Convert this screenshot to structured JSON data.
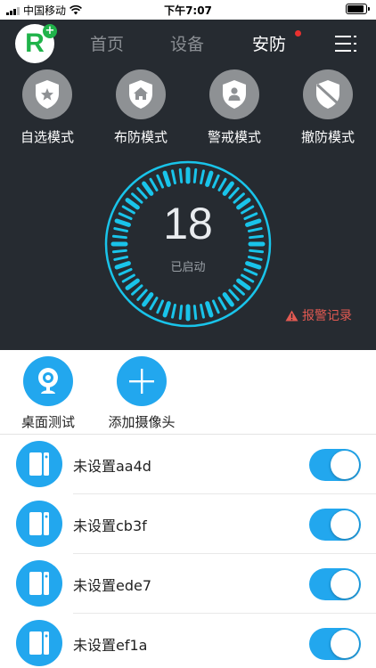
{
  "status_bar": {
    "carrier": "中国移动",
    "time": "下午7:07"
  },
  "nav": {
    "tabs": [
      {
        "label": "首页",
        "active": false
      },
      {
        "label": "设备",
        "active": false
      },
      {
        "label": "安防",
        "active": true,
        "has_notification_dot": true
      }
    ],
    "logo_icon": "app-logo-r-plus",
    "menu_icon": "menu-icon"
  },
  "modes": [
    {
      "label": "自选模式",
      "icon": "star-shield-icon"
    },
    {
      "label": "布防模式",
      "icon": "house-shield-icon"
    },
    {
      "label": "警戒模式",
      "icon": "person-shield-icon"
    },
    {
      "label": "撤防模式",
      "icon": "disarmed-shield-icon"
    }
  ],
  "gauge": {
    "value": "18",
    "status": "已启动"
  },
  "alarm_record": {
    "label": "报警记录",
    "icon": "warning-icon"
  },
  "cameras": [
    {
      "label": "桌面测试",
      "icon": "webcam-icon"
    },
    {
      "label": "添加摄像头",
      "icon": "plus-icon"
    }
  ],
  "devices": [
    {
      "name": "未设置aa4d",
      "enabled": true
    },
    {
      "name": "未设置cb3f",
      "enabled": true
    },
    {
      "name": "未设置ede7",
      "enabled": true
    },
    {
      "name": "未设置ef1a",
      "enabled": true
    }
  ],
  "colors": {
    "header_bg": "#262b31",
    "accent_blue": "#22a7ee",
    "gauge_cyan": "#19c4ea",
    "logo_green": "#20b34a",
    "alert_red": "#e25a52"
  }
}
